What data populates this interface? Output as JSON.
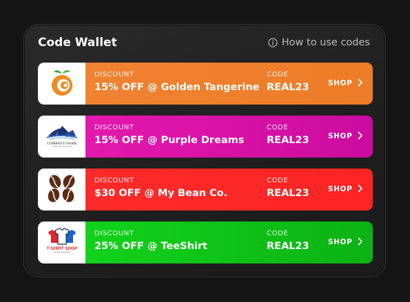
{
  "wallet": {
    "title": "Code Wallet",
    "help_link": "How to use codes",
    "help_icon": "info-circle-icon"
  },
  "offers": [
    {
      "discount_label": "DISCOUNT",
      "discount_text": "15% OFF @ Golden Tangerine",
      "code_label": "CODE",
      "code": "REAL23",
      "shop_label": "SHOP",
      "logo_icon": "tangerine-logo-icon",
      "color": "#ee7d2a"
    },
    {
      "discount_label": "DISCOUNT",
      "discount_text": "15% OFF @ Purple Dreams",
      "code_label": "CODE",
      "code": "REAL23",
      "shop_label": "SHOP",
      "logo_icon": "company-name-logo-icon",
      "logo_caption": "COMPANY NAME",
      "color": "#d810a5"
    },
    {
      "discount_label": "DISCOUNT",
      "discount_text": "$30 OFF @ My Bean Co.",
      "code_label": "CODE",
      "code": "REAL23",
      "shop_label": "SHOP",
      "logo_icon": "coffee-beans-logo-icon",
      "color": "#fd2727"
    },
    {
      "discount_label": "DISCOUNT",
      "discount_text": "25% OFF @ TeeShirt",
      "code_label": "CODE",
      "code": "REAL23",
      "shop_label": "SHOP",
      "logo_icon": "tshirt-shop-logo-icon",
      "logo_caption": "T-SHIRT SHOP",
      "color": "#0ec318"
    }
  ]
}
